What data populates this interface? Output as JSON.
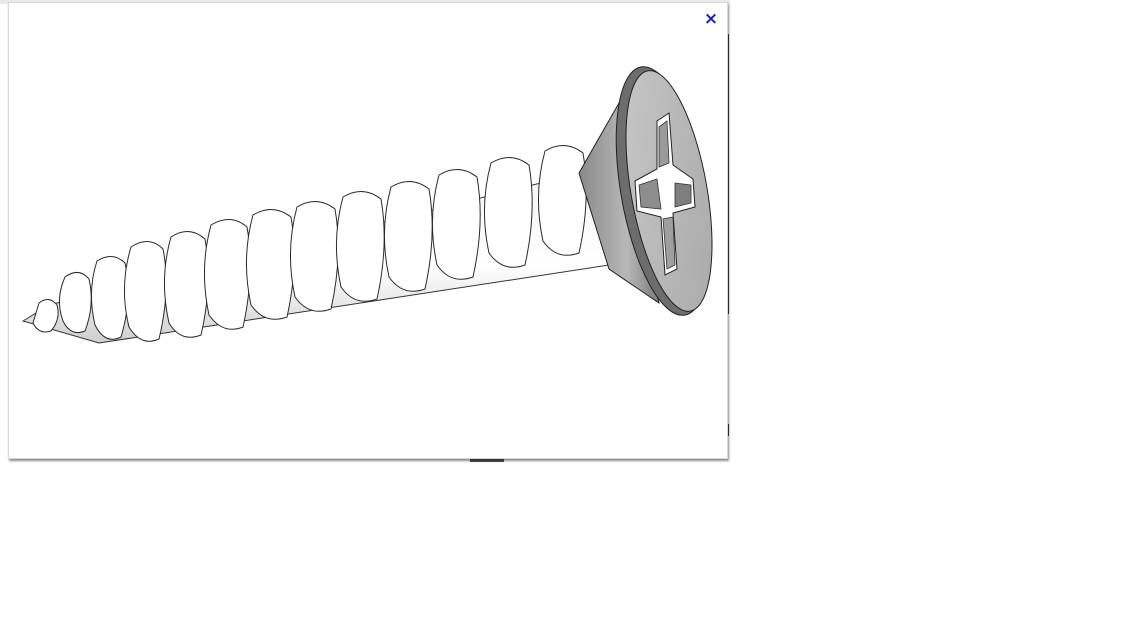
{
  "popup": {
    "close_label": "×",
    "image_subject": "screw-3d-model",
    "close_color": "#1a1ac8"
  }
}
